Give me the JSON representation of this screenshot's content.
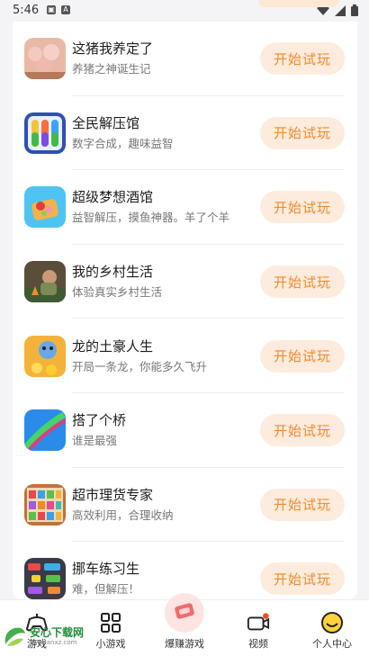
{
  "status_bar": {
    "time": "5:46"
  },
  "games": [
    {
      "name": "这猪我养定了",
      "desc": "养猪之神诞生记",
      "button": "开始试玩",
      "icon": "pigs-game-icon",
      "color": "#e9b9a8"
    },
    {
      "name": "全民解压馆",
      "desc": "数字合成，趣味益智",
      "button": "开始试玩",
      "icon": "color-tubes-game-icon",
      "color": "#2f4fb4"
    },
    {
      "name": "超级梦想酒馆",
      "desc": "益智解压，摸鱼神器。羊了个羊",
      "button": "开始试玩",
      "icon": "food-plate-game-icon",
      "color": "#4fc3f2"
    },
    {
      "name": "我的乡村生活",
      "desc": "体验真实乡村生活",
      "button": "开始试玩",
      "icon": "village-man-game-icon",
      "color": "#5a4d3a"
    },
    {
      "name": "龙的土豪人生",
      "desc": "开局一条龙，你能多久飞升",
      "button": "开始试玩",
      "icon": "dragon-coins-game-icon",
      "color": "#f3b33a"
    },
    {
      "name": "搭了个桥",
      "desc": "谁是最强",
      "button": "开始试玩",
      "icon": "bridge-run-game-icon",
      "color": "#2a8be8"
    },
    {
      "name": "超市理货专家",
      "desc": "高效利用，合理收纳",
      "button": "开始试玩",
      "icon": "shelf-game-icon",
      "color": "#c0713a"
    },
    {
      "name": "挪车练习生",
      "desc": "难，但解压！",
      "button": "开始试玩",
      "icon": "parking-game-icon",
      "color": "#3a3a48"
    }
  ],
  "tabs": [
    {
      "label": "游戏",
      "icon": "gamepad-icon"
    },
    {
      "label": "小游戏",
      "icon": "grid-icon"
    },
    {
      "label": "爆赚游戏",
      "icon": "money-icon"
    },
    {
      "label": "视频",
      "icon": "video-icon"
    },
    {
      "label": "个人中心",
      "icon": "smile-face-icon"
    }
  ],
  "watermark": {
    "title": "安心下载网",
    "url": "www.anxz.com"
  }
}
